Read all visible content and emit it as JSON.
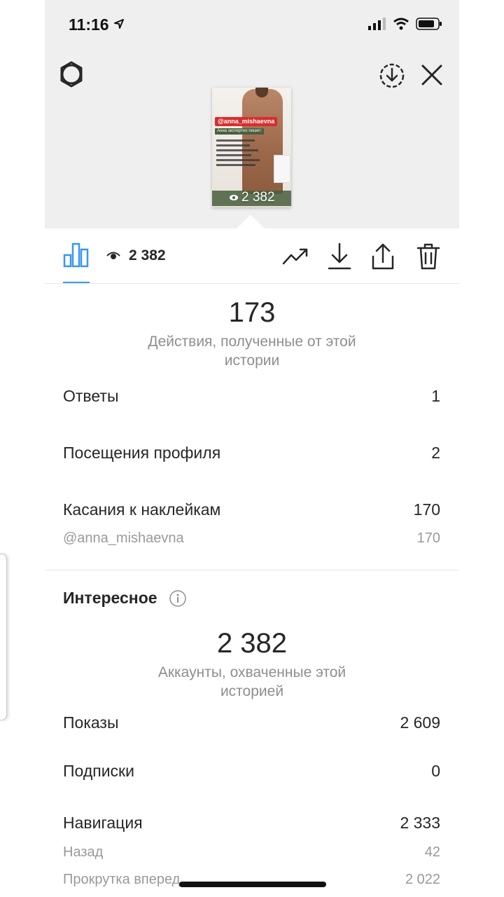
{
  "status_bar": {
    "time": "11:16"
  },
  "story": {
    "tag": "@anna_mishaevna",
    "subtitle": "Анна экспертно пишет:",
    "views": "2 382"
  },
  "toolbar": {
    "views": "2 382"
  },
  "actions": {
    "total": "173",
    "caption": "Действия, полученные от этой истории",
    "rows": [
      {
        "label": "Ответы",
        "value": "1"
      },
      {
        "label": "Посещения профиля",
        "value": "2"
      },
      {
        "label": "Касания к наклейкам",
        "value": "170"
      }
    ],
    "sticker_detail": {
      "label": "@anna_mishaevna",
      "value": "170"
    }
  },
  "discovery": {
    "title": "Интересное",
    "total": "2 382",
    "caption": "Аккаунты, охваченные этой историей",
    "rows": [
      {
        "label": "Показы",
        "value": "2 609"
      },
      {
        "label": "Подписки",
        "value": "0"
      },
      {
        "label": "Навигация",
        "value": "2 333"
      }
    ],
    "nav_detail": [
      {
        "label": "Назад",
        "value": "42"
      },
      {
        "label": "Прокрутка вперед",
        "value": "2 022"
      }
    ]
  },
  "colors": {
    "accent": "#3897f0",
    "muted": "#8e8e8e",
    "text": "#262626"
  },
  "icons": [
    "settings-icon",
    "download-circle-icon",
    "close-icon",
    "insights-icon",
    "eye-icon",
    "trending-icon",
    "download-icon",
    "share-icon",
    "trash-icon",
    "info-icon"
  ]
}
